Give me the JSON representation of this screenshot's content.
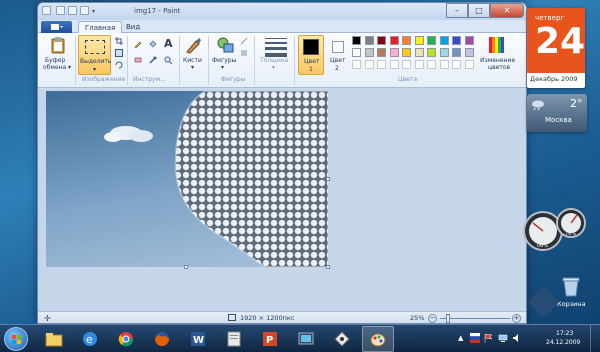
{
  "window": {
    "title": "img17 - Paint",
    "controls": {
      "minimize": "–",
      "maximize": "□",
      "close": "✕"
    }
  },
  "tabs": [
    {
      "label": "Главная"
    },
    {
      "label": "Вид"
    }
  ],
  "ribbon": {
    "clipboard": {
      "label_1": "Буфер",
      "label_2": "обмена",
      "arrow": "▾"
    },
    "image": {
      "select_label": "Выделить",
      "arrow": "▾",
      "group_label": "Изображение"
    },
    "tools": {
      "group_label": "Инструм..."
    },
    "brushes": {
      "label": "Кисти",
      "arrow": "▾"
    },
    "shapes": {
      "label": "Фигуры",
      "arrow": "▾",
      "group_label": "Фигуры"
    },
    "size": {
      "label": "Толщина",
      "arrow": "▾"
    },
    "color1": {
      "label": "Цвет",
      "number": "1"
    },
    "color2": {
      "label": "Цвет",
      "number": "2"
    },
    "edit_colors": {
      "label_1": "Изменение",
      "label_2": "цветов"
    },
    "colors_group_label": "Цвета",
    "palette_row1": [
      "#000000",
      "#7f7f7f",
      "#880015",
      "#ed1c24",
      "#ff7f27",
      "#fff200",
      "#22b14c",
      "#00a2e8",
      "#3f48cc",
      "#a349a4"
    ],
    "palette_row2": [
      "#ffffff",
      "#c3c3c3",
      "#b97a57",
      "#ffaec9",
      "#ffc90e",
      "#efe4b0",
      "#b5e61d",
      "#99d9ea",
      "#7092be",
      "#c8bfe7"
    ]
  },
  "statusbar": {
    "dimensions": "1920 × 1200пкс",
    "zoom": "25%",
    "zoom_out": "−",
    "zoom_in": "+"
  },
  "calendar": {
    "weekday": "четверг",
    "day": "24",
    "month_year": "Декабрь 2009"
  },
  "weather": {
    "temp": "2°",
    "city": "Москва"
  },
  "gauges": {
    "cpu": "06%",
    "mem": "76%"
  },
  "desktop": {
    "recycle_bin": "Корзина"
  },
  "taskbar": {
    "time": "17:23",
    "date": "24.12.2009",
    "apps": [
      "start",
      "ie",
      "chrome",
      "firefox",
      "word",
      "powerpoint",
      "mmc",
      "paint-dots",
      "recycle",
      "paint"
    ]
  }
}
